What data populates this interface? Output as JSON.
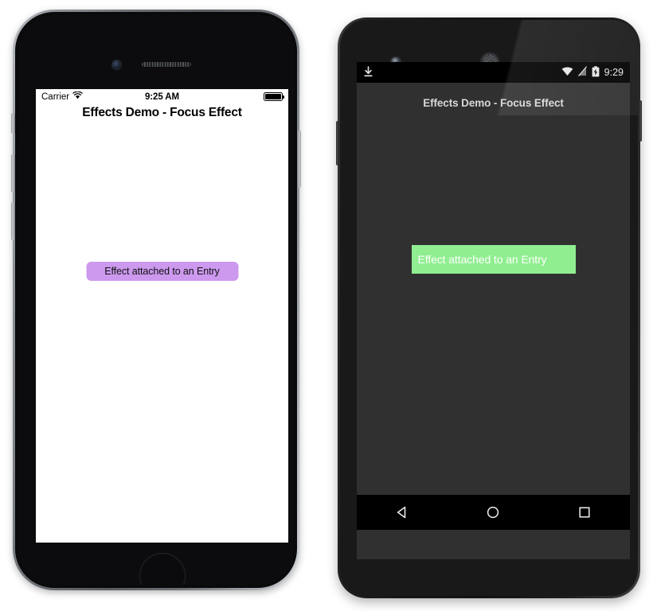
{
  "ios": {
    "platform_name": "iOS",
    "status_bar": {
      "carrier": "Carrier",
      "wifi_icon": "wifi-icon",
      "time": "9:25 AM",
      "battery_icon": "battery-full-icon"
    },
    "title": "Effects Demo - Focus Effect",
    "entry": {
      "value": "Effect attached to an Entry",
      "background_color": "#cc99ee",
      "text_color": "#111111"
    },
    "screen_background": "#ffffff",
    "hardware": {
      "camera": "front-camera",
      "speaker": "earpiece-speaker",
      "home_button": "home-button",
      "mute_switch": "mute-switch",
      "volume_up": "volume-up-button",
      "volume_down": "volume-down-button",
      "power": "power-button"
    }
  },
  "android": {
    "platform_name": "Android",
    "status_bar": {
      "download_icon": "download-icon",
      "wifi_icon": "wifi-icon",
      "signal_icon": "no-sim-icon",
      "battery_icon": "battery-charging-icon",
      "time": "9:29"
    },
    "title": "Effects Demo - Focus Effect",
    "entry": {
      "value": "Effect attached to an Entry",
      "background_color": "#90ee90",
      "text_color": "#ffffff"
    },
    "screen_background": "#303030",
    "nav_bar": {
      "back": "back-nav-icon",
      "home": "home-nav-icon",
      "recents": "recents-nav-icon"
    },
    "hardware": {
      "camera": "front-camera",
      "speaker": "earpiece-speaker",
      "sensors": "proximity-sensors",
      "volume": "volume-rocker",
      "power": "power-button"
    }
  }
}
